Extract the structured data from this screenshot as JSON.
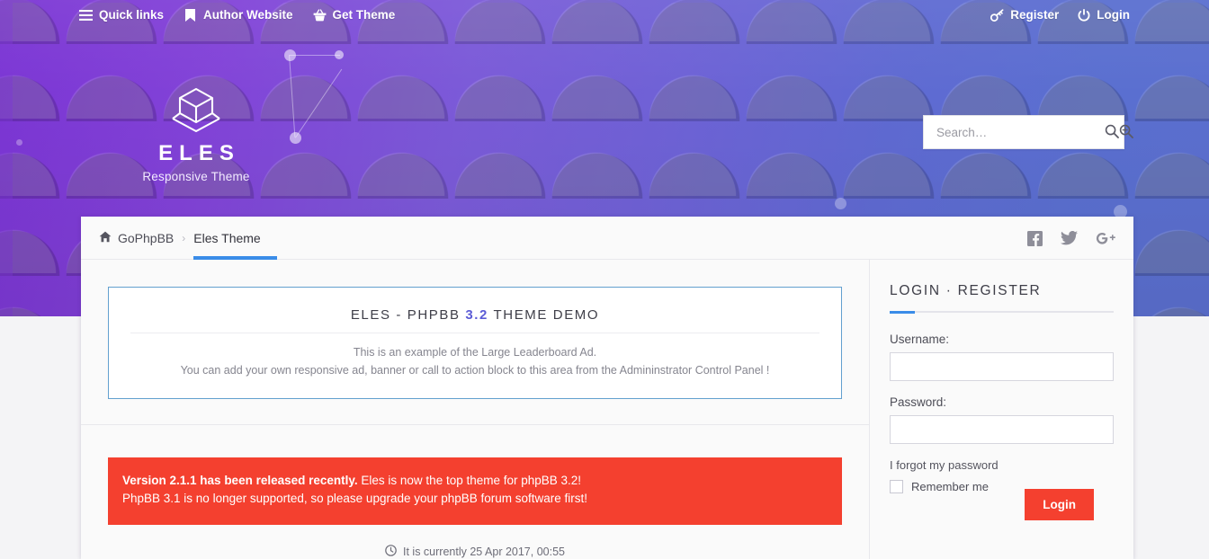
{
  "topbar": {
    "left_items": [
      {
        "label": "Quick links",
        "icon": "hamburger-icon"
      },
      {
        "label": "Author Website",
        "icon": "bookmark-icon"
      },
      {
        "label": "Get Theme",
        "icon": "basket-icon"
      }
    ],
    "right_items": [
      {
        "label": "Register",
        "icon": "key-icon"
      },
      {
        "label": "Login",
        "icon": "power-icon"
      }
    ]
  },
  "brand": {
    "title": "ELES",
    "subtitle": "Responsive Theme",
    "logo_icon": "cube-logo-icon"
  },
  "search": {
    "placeholder": "Search…",
    "value": "",
    "search_icon": "search-icon",
    "advanced_icon": "advanced-search-icon"
  },
  "breadcrumb": {
    "home_icon": "home-icon",
    "separator": "›",
    "items": [
      {
        "label": "GoPhpBB",
        "active": false
      },
      {
        "label": "Eles Theme",
        "active": true
      }
    ]
  },
  "socials": [
    {
      "name": "facebook-icon",
      "label": "f"
    },
    {
      "name": "twitter-icon",
      "label": ""
    },
    {
      "name": "google-plus-icon",
      "label": "G+"
    }
  ],
  "ad": {
    "title_pre": "ELES - PHPBB ",
    "title_highlight": "3.2",
    "title_post": " THEME DEMO",
    "line1": "This is an example of the Large Leaderboard Ad.",
    "line2": "You can add your own responsive ad, banner or call to action block to this area from the Admininstrator Control Panel !"
  },
  "alert": {
    "line1_bold": "Version 2.1.1 has been released recently.",
    "line1_rest": " Eles is now the top theme for phpBB 3.2!",
    "line2": "PhpBB 3.1 is no longer supported, so please upgrade your phpBB forum software first!"
  },
  "currently": {
    "icon": "clock-icon",
    "text": "It is currently 25 Apr 2017, 00:55"
  },
  "login": {
    "title": "LOGIN · REGISTER",
    "username_label": "Username:",
    "username_value": "",
    "password_label": "Password:",
    "password_value": "",
    "forgot_label": "I forgot my password",
    "remember_label": "Remember me",
    "remember_checked": false,
    "button_label": "Login"
  },
  "colors": {
    "accent_blue": "#3a8ce8",
    "alert_red": "#f4402f",
    "highlight_purple": "#5c5cd6",
    "header_purple": "#7b35d4",
    "header_blue": "#5b6fcf"
  }
}
